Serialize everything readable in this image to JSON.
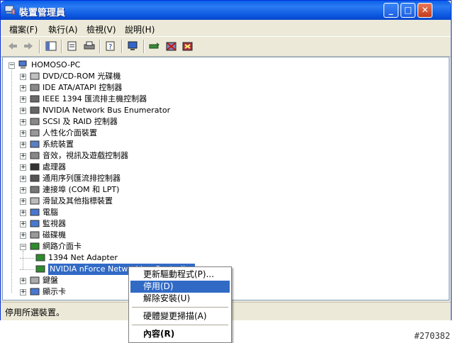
{
  "window": {
    "title": "裝置管理員",
    "minimize": "_",
    "maximize": "□",
    "close": "✕"
  },
  "menu": [
    "檔案(F)",
    "執行(A)",
    "檢視(V)",
    "說明(H)"
  ],
  "toolbar_icons": [
    "back-arrow-icon",
    "forward-arrow-icon",
    "properties-pane-icon",
    "properties-icon",
    "print-icon",
    "help-icon",
    "monitor-icon",
    "update-driver-icon",
    "disable-device-icon",
    "uninstall-device-icon"
  ],
  "tree": {
    "root": "HOMOSO-PC",
    "items": [
      {
        "label": "DVD/CD-ROM 光碟機",
        "icon": "cdrom-icon",
        "state": "+"
      },
      {
        "label": "IDE ATA/ATAPI 控制器",
        "icon": "ide-icon",
        "state": "+"
      },
      {
        "label": "IEEE 1394 匯流排主機控制器",
        "icon": "firewire-icon",
        "state": "+"
      },
      {
        "label": "NVIDIA Network Bus Enumerator",
        "icon": "network-bus-icon",
        "state": "+"
      },
      {
        "label": "SCSI 及 RAID 控制器",
        "icon": "scsi-icon",
        "state": "+"
      },
      {
        "label": "人性化介面裝置",
        "icon": "hid-icon",
        "state": "+"
      },
      {
        "label": "系統裝置",
        "icon": "system-icon",
        "state": "+"
      },
      {
        "label": "音效，視訊及遊戲控制器",
        "icon": "sound-icon",
        "state": "+"
      },
      {
        "label": "處理器",
        "icon": "cpu-icon",
        "state": "+"
      },
      {
        "label": "通用序列匯流排控制器",
        "icon": "usb-icon",
        "state": "+"
      },
      {
        "label": "連接埠 (COM 和 LPT)",
        "icon": "port-icon",
        "state": "+"
      },
      {
        "label": "滑鼠及其他指標裝置",
        "icon": "mouse-icon",
        "state": "+"
      },
      {
        "label": "電腦",
        "icon": "computer-icon",
        "state": "+"
      },
      {
        "label": "監視器",
        "icon": "monitor-icon",
        "state": "+"
      },
      {
        "label": "磁碟機",
        "icon": "disk-icon",
        "state": "+"
      },
      {
        "label": "網路介面卡",
        "icon": "network-card-icon",
        "state": "-"
      },
      {
        "label": "1394 Net Adapter",
        "icon": "network-card-icon",
        "state": "child"
      },
      {
        "label": "NVIDIA nForce Networking Controller",
        "icon": "network-card-icon",
        "state": "child-selected"
      },
      {
        "label": "鍵盤",
        "icon": "keyboard-icon",
        "state": "+"
      },
      {
        "label": "顯示卡",
        "icon": "display-icon",
        "state": "+"
      }
    ]
  },
  "status": "停用所選裝置。",
  "context_menu": {
    "items": [
      "更新驅動程式(P)...",
      "停用(D)",
      "解除安裝(U)",
      "硬體變更掃描(A)",
      "內容(R)"
    ],
    "highlighted": "停用(D)"
  },
  "watermark": "#270382",
  "colors": {
    "selection": "#316ac5",
    "titlebar": "#0a5fe8",
    "chrome": "#ece9d8"
  }
}
